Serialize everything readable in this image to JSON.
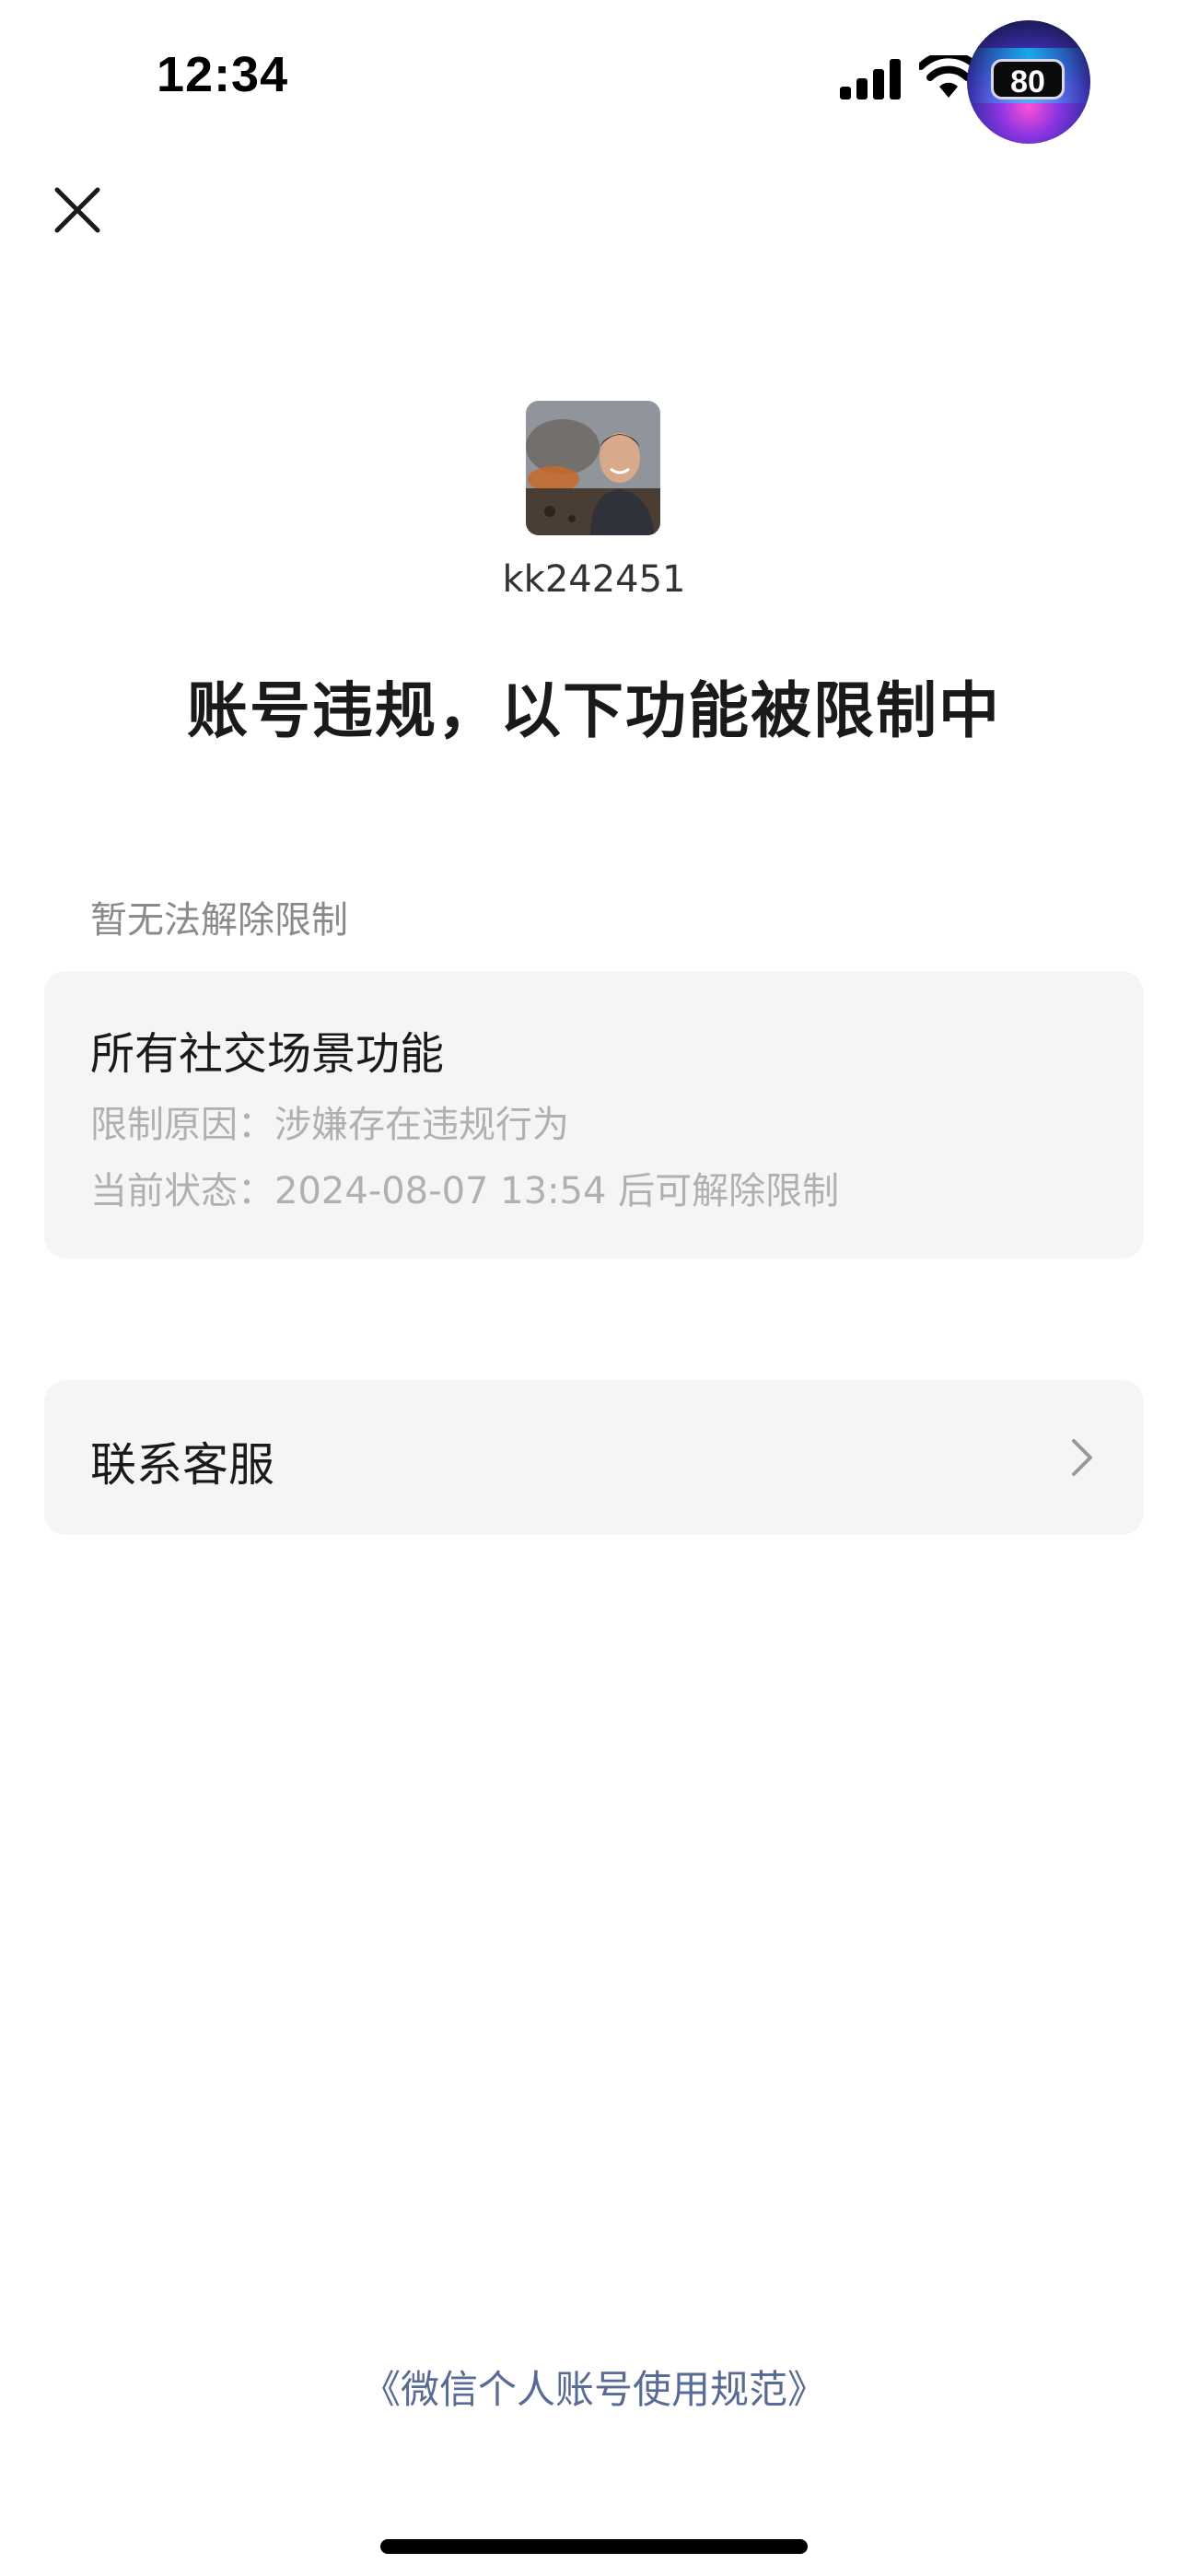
{
  "status_bar": {
    "time": "12:34",
    "battery": "80",
    "icons": [
      "signal-icon",
      "wifi-icon",
      "battery-icon"
    ]
  },
  "header": {
    "close_icon": "close-icon"
  },
  "profile": {
    "username": "kk242451"
  },
  "page_title": "账号违规，以下功能被限制中",
  "section_label": "暂无法解除限制",
  "restriction": {
    "title": "所有社交场景功能",
    "reason_label": "限制原因：",
    "reason_value": "涉嫌存在违规行为",
    "state_label": "当前状态：",
    "state_value": "2024-08-07 13:54 后可解除限制"
  },
  "contact": {
    "label": "联系客服",
    "icon": "chevron-right-icon"
  },
  "footer": {
    "policy_link": "《微信个人账号使用规范》"
  },
  "colors": {
    "background": "#ffffff",
    "card": "#f5f5f5",
    "muted_text": "#b0b0b0",
    "label_text": "#8a8a8a",
    "link": "#576b95"
  }
}
